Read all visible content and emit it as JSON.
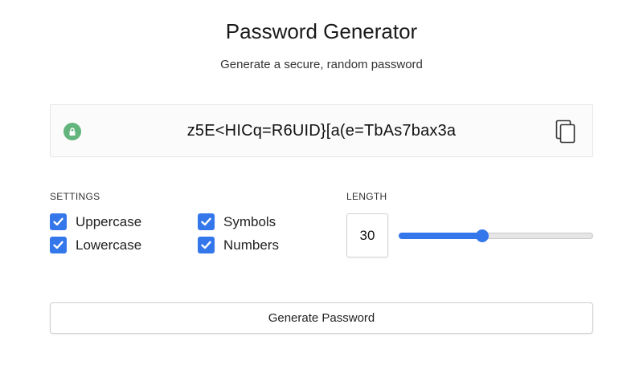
{
  "header": {
    "title": "Password Generator",
    "subtitle": "Generate a secure, random password"
  },
  "password": {
    "value": "z5E<HICq=R6UID}[a(e=TbAs7bax3a",
    "lock_icon": "lock-icon",
    "copy_icon": "copy-icon"
  },
  "settings": {
    "label": "SETTINGS",
    "options": [
      {
        "label": "Uppercase",
        "checked": true
      },
      {
        "label": "Symbols",
        "checked": true
      },
      {
        "label": "Lowercase",
        "checked": true
      },
      {
        "label": "Numbers",
        "checked": true
      }
    ]
  },
  "length": {
    "label": "LENGTH",
    "value": "30",
    "slider_fraction": 0.43
  },
  "actions": {
    "generate_label": "Generate Password"
  },
  "colors": {
    "accent": "#3477eb",
    "lock_badge": "#62b57c",
    "text": "#222222"
  }
}
